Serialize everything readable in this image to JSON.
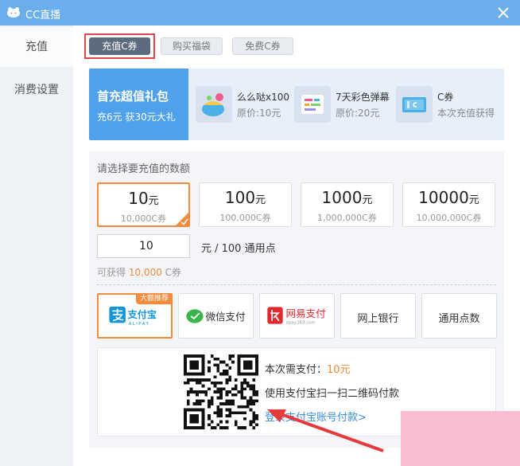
{
  "window": {
    "title": "CC直播"
  },
  "sidebar": {
    "items": [
      {
        "label": "充值"
      },
      {
        "label": "消费设置"
      }
    ]
  },
  "tabs": [
    {
      "label": "充值C券"
    },
    {
      "label": "购买福袋"
    },
    {
      "label": "免费C券"
    }
  ],
  "banner": {
    "title": "首充超值礼包",
    "subtitle": "充6元 获30元大礼",
    "gifts": [
      {
        "name": "么么哒x100",
        "price": "原价:10元",
        "icon": "gift-box-icon"
      },
      {
        "name": "7天彩色弹幕",
        "price": "原价:20元",
        "icon": "color-danmaku-icon"
      },
      {
        "name": "C券",
        "price": "本次充值获得",
        "icon": "coupon-icon"
      }
    ]
  },
  "recharge": {
    "label": "请选择要充值的数额",
    "options": [
      {
        "amount": "10",
        "unit": "元",
        "coupons": "10,000C券"
      },
      {
        "amount": "100",
        "unit": "元",
        "coupons": "100,000C券"
      },
      {
        "amount": "1000",
        "unit": "元",
        "coupons": "1,000,000C券"
      },
      {
        "amount": "10000",
        "unit": "元",
        "coupons": "10,000,000C券"
      }
    ],
    "custom_value": "10",
    "custom_unit": "元 / 100 通用点",
    "obtain_prefix": "可获得",
    "obtain_value": "10,000",
    "obtain_suffix": "C券"
  },
  "payment": {
    "badge": "大额推荐",
    "methods": [
      {
        "label": "支付宝",
        "sub": "ALIPAY"
      },
      {
        "label": "微信支付"
      },
      {
        "label": "网易支付",
        "sub": "epay.163.com"
      },
      {
        "label": "网上银行"
      },
      {
        "label": "通用点数"
      }
    ]
  },
  "qr_panel": {
    "pay_prefix": "本次需支付：",
    "pay_amount": "10元",
    "instruction": "使用支付宝扫一扫二维码付款",
    "login_link": "登录支付宝账号付款>"
  },
  "colors": {
    "accent": "#f28b3c",
    "titlebar": "#6aaeeb",
    "link": "#3b8de0",
    "highlight_box": "#e1454b"
  }
}
